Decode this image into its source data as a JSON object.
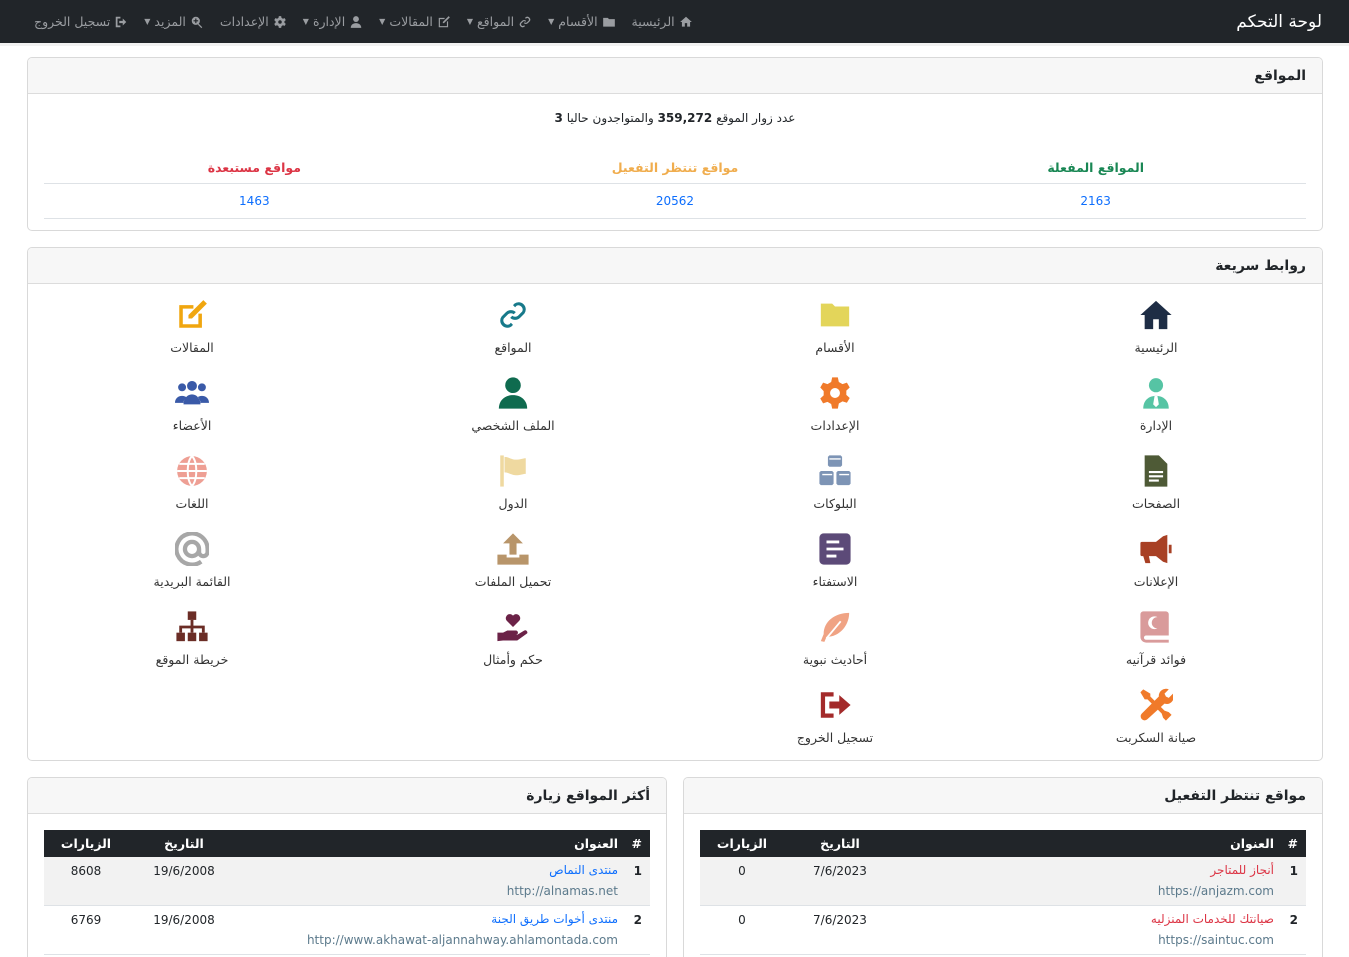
{
  "navbar": {
    "brand": "لوحة التحكم",
    "items": [
      {
        "label": "الرئيسية",
        "icon": "home-icon",
        "dropdown": false
      },
      {
        "label": "الأقسام",
        "icon": "folder-icon",
        "dropdown": true
      },
      {
        "label": "المواقع",
        "icon": "link-icon",
        "dropdown": true
      },
      {
        "label": "المقالات",
        "icon": "edit-icon",
        "dropdown": true
      },
      {
        "label": "الإدارة",
        "icon": "user-tie-icon",
        "dropdown": true
      },
      {
        "label": "الإعدادات",
        "icon": "gear-icon",
        "dropdown": false
      },
      {
        "label": "المزيد",
        "icon": "search-plus-icon",
        "dropdown": true
      },
      {
        "label": "تسجيل الخروج",
        "icon": "sign-out-icon",
        "dropdown": false
      }
    ]
  },
  "sites_card": {
    "title": "المواقع",
    "visitors_prefix": "عدد زوار الموقع",
    "visitors_count": "359,272",
    "online_prefix": "والمتواجدون حاليا",
    "online_count": "3",
    "headers": {
      "active": "المواقع المفعلة",
      "pending": "مواقع تنتظر التفعيل",
      "excluded": "مواقع مستبعدة"
    },
    "values": {
      "active": "2163",
      "pending": "20562",
      "excluded": "1463"
    }
  },
  "quick_links": {
    "title": "روابط سريعة",
    "items": [
      {
        "label": "الرئيسية",
        "icon": "home-icon",
        "color": "#1e2d45"
      },
      {
        "label": "الأقسام",
        "icon": "folder-icon",
        "color": "#e3d55a"
      },
      {
        "label": "المواقع",
        "icon": "link-icon",
        "color": "#17798a"
      },
      {
        "label": "المقالات",
        "icon": "edit-icon",
        "color": "#f0a60f"
      },
      {
        "label": "الإدارة",
        "icon": "user-tie-icon",
        "color": "#56c4a4"
      },
      {
        "label": "الإعدادات",
        "icon": "gear-icon",
        "color": "#f07a2a"
      },
      {
        "label": "الملف الشخصي",
        "icon": "user-icon",
        "color": "#0f6b4f"
      },
      {
        "label": "الأعضاء",
        "icon": "users-icon",
        "color": "#3a5aa8"
      },
      {
        "label": "الصفحات",
        "icon": "file-icon",
        "color": "#4e5a36"
      },
      {
        "label": "البلوكات",
        "icon": "cubes-icon",
        "color": "#7d94b5"
      },
      {
        "label": "الدول",
        "icon": "flag-icon",
        "color": "#efd9a0"
      },
      {
        "label": "اللغات",
        "icon": "globe-icon",
        "color": "#ee9f94"
      },
      {
        "label": "الإعلانات",
        "icon": "bullhorn-icon",
        "color": "#a84024"
      },
      {
        "label": "الاستفتاء",
        "icon": "poll-icon",
        "color": "#5c4a78"
      },
      {
        "label": "تحميل الملفات",
        "icon": "upload-icon",
        "color": "#b8956a"
      },
      {
        "label": "القائمة البريدية",
        "icon": "at-icon",
        "color": "#a7a7a7"
      },
      {
        "label": "فوائد قرآنيه",
        "icon": "quran-icon",
        "color": "#d99b9b"
      },
      {
        "label": "أحاديث نبوية",
        "icon": "feather-icon",
        "color": "#f0a384"
      },
      {
        "label": "حكم وأمثال",
        "icon": "hand-heart-icon",
        "color": "#6b2247"
      },
      {
        "label": "خريطة الموقع",
        "icon": "sitemap-icon",
        "color": "#6b2d26"
      },
      {
        "label": "صيانة السكربت",
        "icon": "tools-icon",
        "color": "#f07a2a"
      },
      {
        "label": "تسجيل الخروج",
        "icon": "sign-out-icon",
        "color": "#a32a2a"
      }
    ]
  },
  "pending_card": {
    "title": "مواقع تنتظر التفعيل",
    "columns": [
      "#",
      "العنوان",
      "التاريخ",
      "الزيارات"
    ],
    "rows": [
      {
        "num": "1",
        "title": "أنجاز للمتاجر",
        "url": "https://anjazm.com",
        "date": "7/6/2023",
        "visits": "0"
      },
      {
        "num": "2",
        "title": "صيانتك للخدمات المنزليه",
        "url": "https://saintuc.com",
        "date": "7/6/2023",
        "visits": "0"
      }
    ]
  },
  "top_card": {
    "title": "أكثر المواقع زيارة",
    "columns": [
      "#",
      "العنوان",
      "التاريخ",
      "الزيارات"
    ],
    "rows": [
      {
        "num": "1",
        "title": "منتدى النماص",
        "url": "http://alnamas.net",
        "date": "19/6/2008",
        "visits": "8608"
      },
      {
        "num": "2",
        "title": "منتدى أخوات طريق الجنة",
        "url": "http://www.akhawat-aljannahway.ahlamontada.com",
        "date": "19/6/2008",
        "visits": "6769"
      }
    ]
  }
}
